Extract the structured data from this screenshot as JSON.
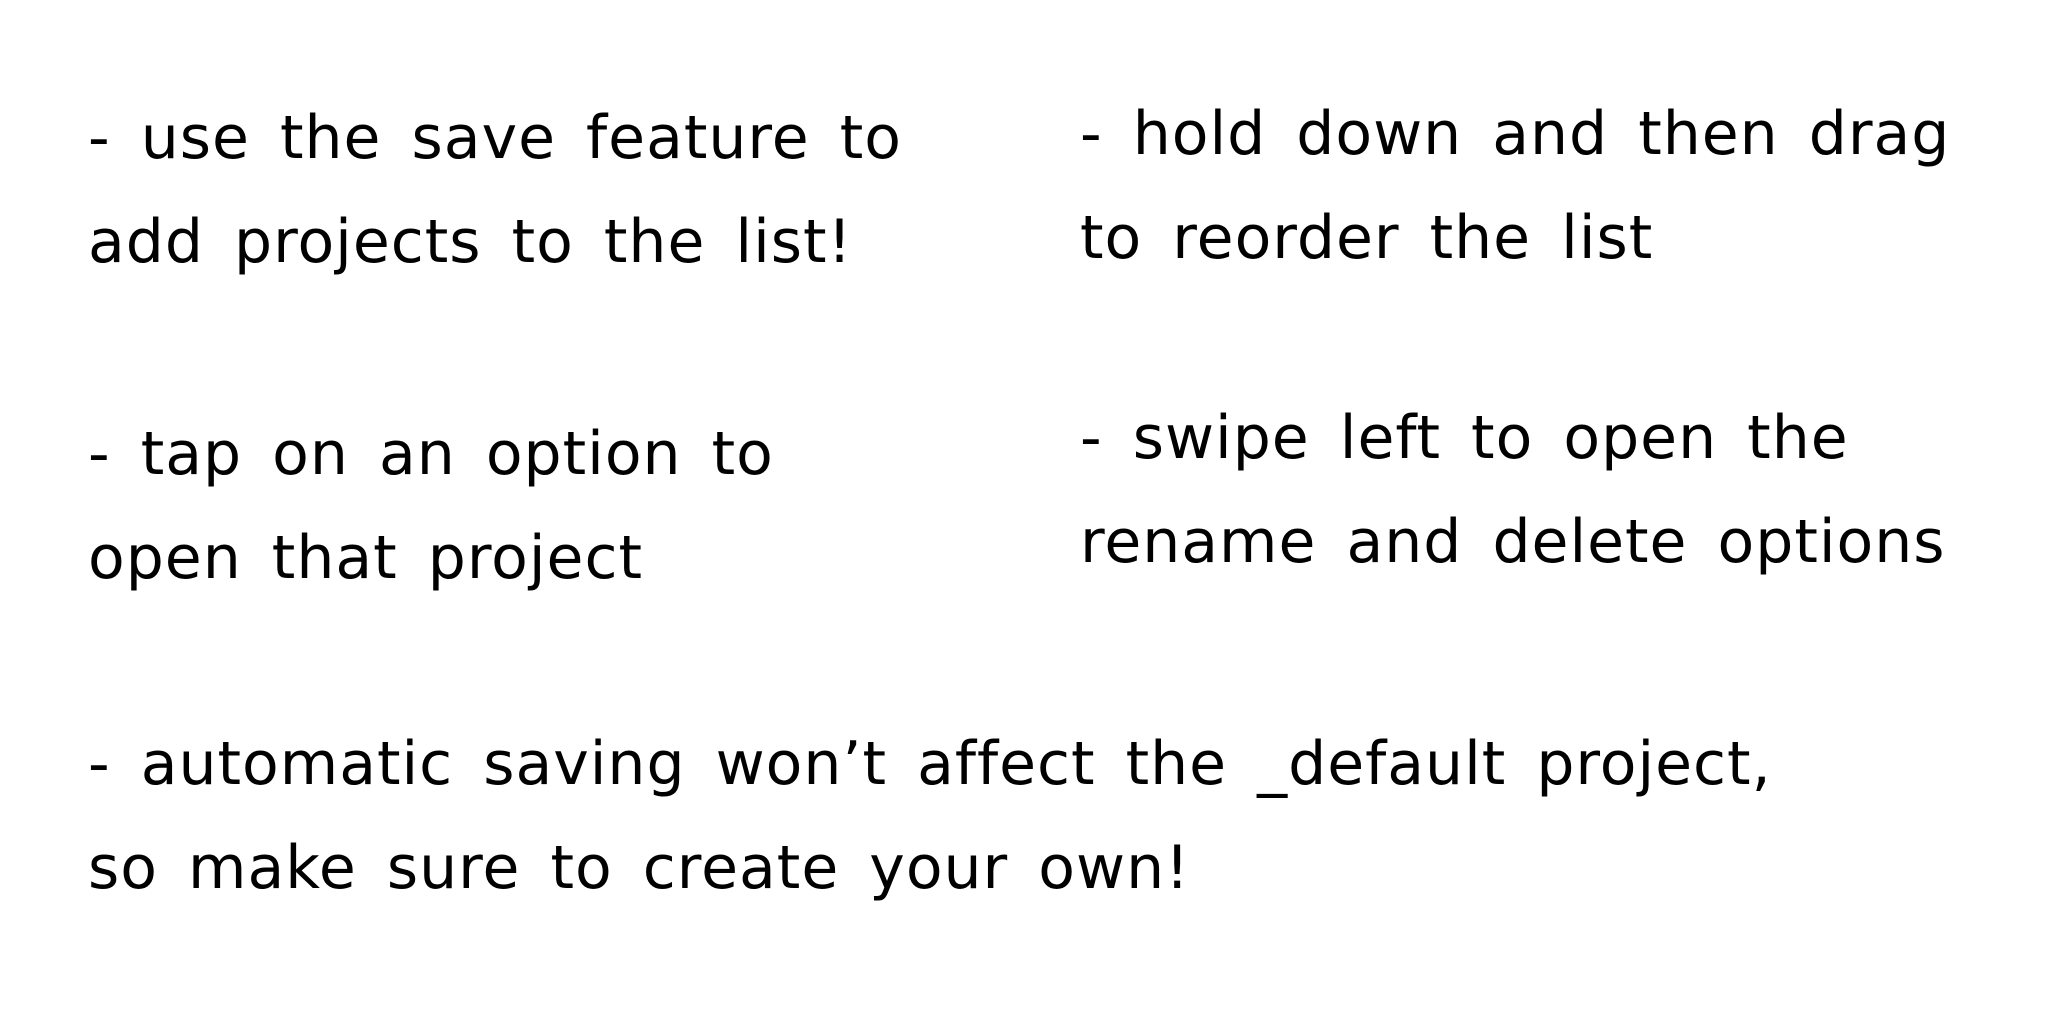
{
  "tips": {
    "save": {
      "line1": "- use the save feature to",
      "line2": "add projects to the list!"
    },
    "reorder": {
      "line1": "- hold down and then drag",
      "line2": "to reorder the list"
    },
    "open": {
      "line1": "- tap on an option to",
      "line2": "open that project"
    },
    "swipe": {
      "line1": "- swipe left to open the",
      "line2": "rename and delete options"
    },
    "autosave": {
      "line1": "- automatic saving won’t affect the _default project,",
      "line2": "so make sure to create your own!"
    }
  }
}
